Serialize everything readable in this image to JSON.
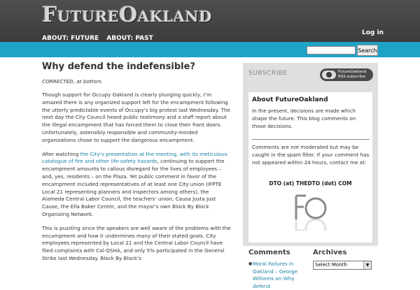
{
  "header": {
    "site_title": "FutureOakland",
    "nav": [
      "ABOUT: FUTURE",
      "ABOUT: PAST"
    ],
    "login": "Log in"
  },
  "search": {
    "placeholder": "",
    "button": "Search"
  },
  "post": {
    "title": "Why defend the indefensible?",
    "corrected": "CORRECTED, at bottom.",
    "p1": "Though support for Occupy Oakland is clearly plunging quickly, I’m amazed there is any organized support left for the encampment following the utterly predictable events of Occupy’s big protest last Wednesday. The next day the City Council heard public testimony and a staff report about the illegal encampment that has forced them to close their front doors. Unfortunately, ostensibly responsible and community-minded organizations chose to support the dangerous encampment.",
    "p2_prefix": "After watching ",
    "p2_link": "the City’s presentation at the meeting, with its meticulous catalogue of fire and other life-safety hazards",
    "p2_suffix": ", continuing to support the encampment amounts to callous disregard for the lives of employees – and, yes, residents – on the Plaza. Yet public comment in favor of the encampment included representatives of at least one City union (IFPTE Local 21 representing planners and inspectors among others), the Alameda Central Labor Council, the teachers’ union, Causa Justa Just Cause, the Ella Baker Center, and the mayor’s own Block By Block Organizing Network.",
    "p3": "This is puzzling since the speakers are well aware of the problems with the encampment and how it undermines many of their stated goals. City employees represented by Local 21 and the Central Labor Council have filed complaints with Cal-OSHA, and only 5% participated in the General Strike last Wednesday. Block By Block’s"
  },
  "sidebar": {
    "subscribe": "SUBSCRIBE",
    "rss_line1": "FutureOakland",
    "rss_line2": "RSS subscribe",
    "about_title": "About FutureOakland",
    "about_text": "In the present, decisions are made which shape the future. This blog comments on those decisions.",
    "comments_note": "Comments are not moderated but may be caught in the spam filter. If your comment has not appeared within 24 hours, contact me at:",
    "email": "DTO (at) THEDTO (dot) COM",
    "logo_text": "FO"
  },
  "widgets": {
    "comments_heading": "Comments",
    "comment_1": "Moral Failures in Oakland – George Williams on Why defend",
    "archives_heading": "Archives",
    "archives_selected": "Select Month"
  },
  "colors": {
    "header_bg": "#464648",
    "teal_bar": "#1ea3c7",
    "link": "#1a7fa6",
    "sidebar_bg": "#dfdfdf"
  }
}
